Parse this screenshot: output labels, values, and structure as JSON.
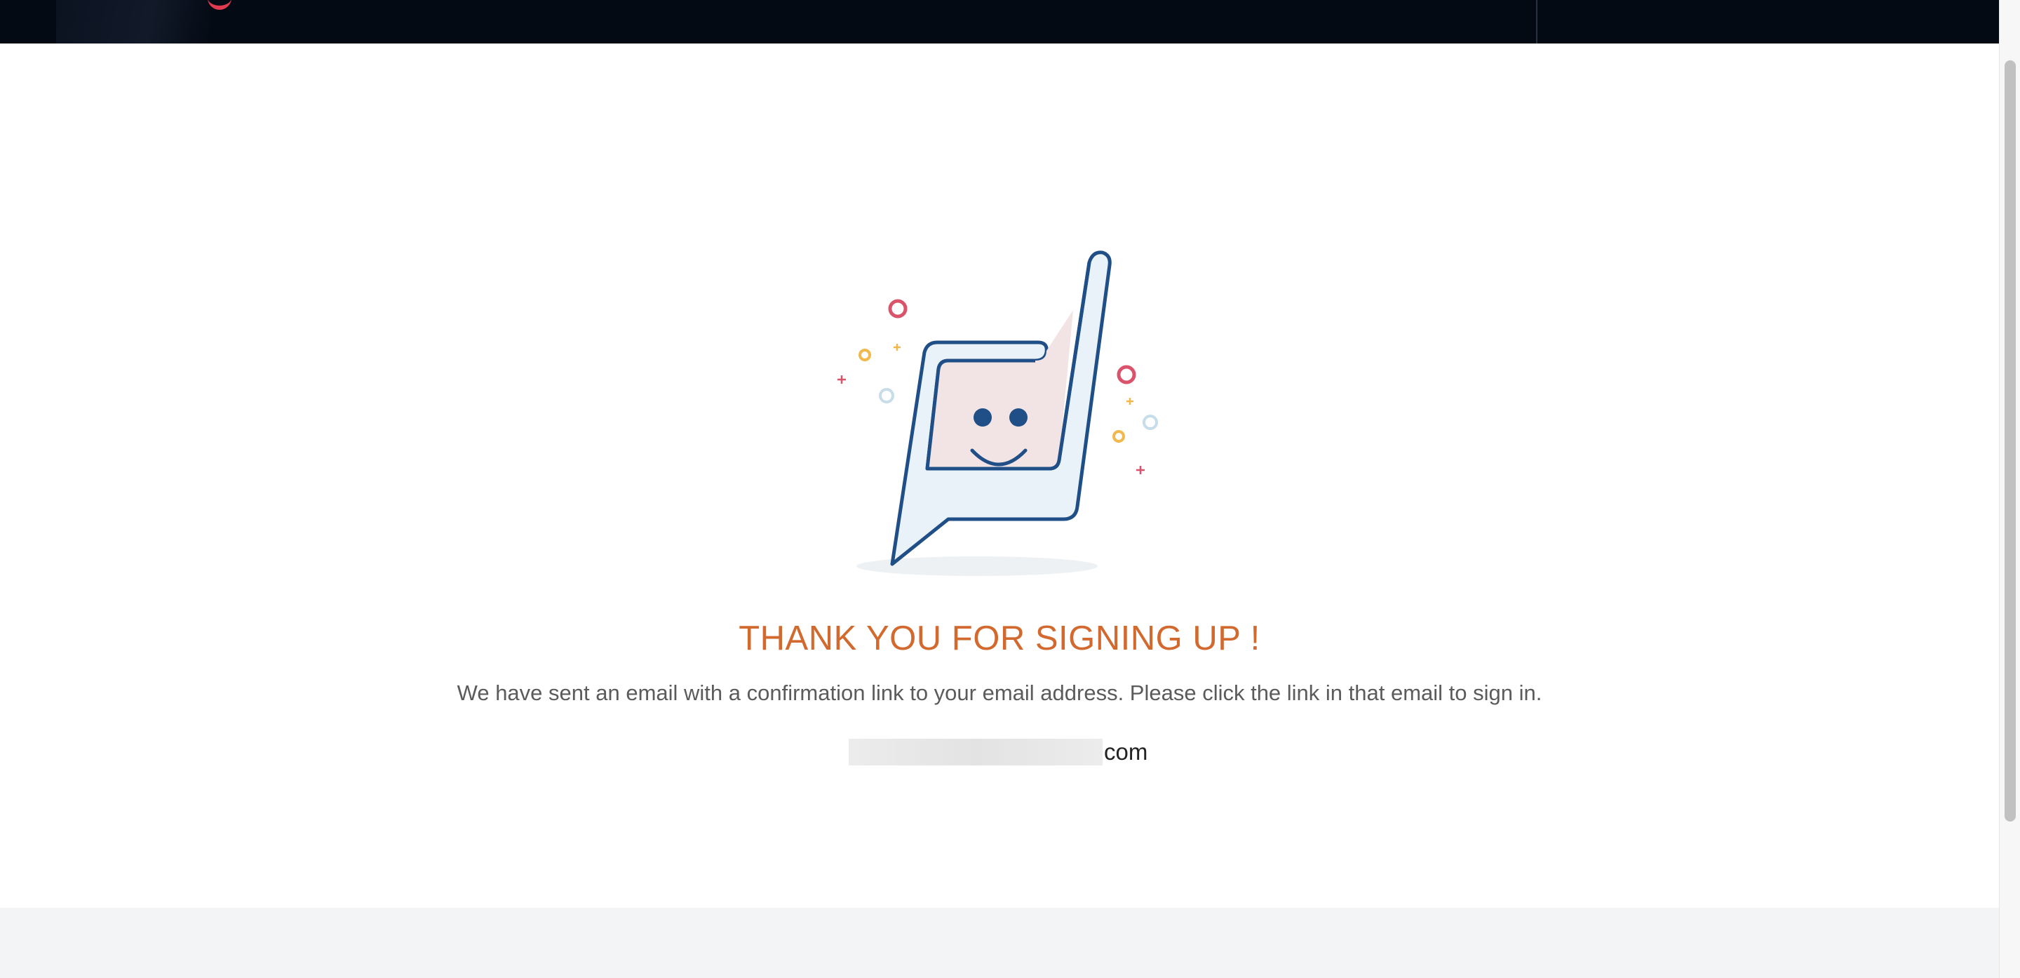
{
  "confirmation": {
    "heading": "THANK YOU FOR SIGNING UP !",
    "message": "We have sent an email with a confirmation link to your email address. Please click the link in that email to sign in.",
    "email_suffix": "com"
  },
  "colors": {
    "heading": "#d2692e",
    "message": "#5b5b5b",
    "banner": "#040a14",
    "footer": "#f3f4f6"
  },
  "icons": {
    "illustration": "smiling-chat-bubble-icon"
  }
}
